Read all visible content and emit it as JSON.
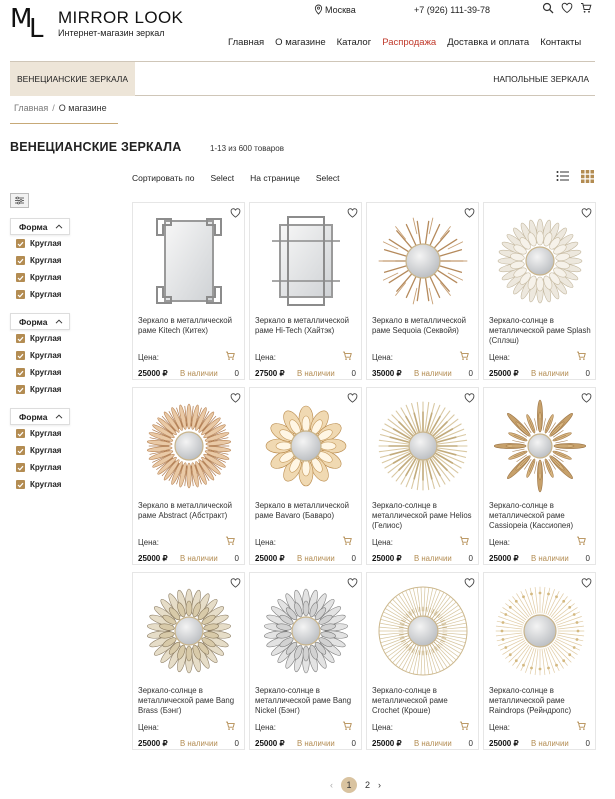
{
  "header": {
    "brand": "MIRROR LOOK",
    "tagline": "Интернет-магазин зеркал",
    "logo_m": "M",
    "logo_l": "L",
    "city": "Москва",
    "phone": "+7 (926) 111-39-78",
    "nav": [
      "Главная",
      "О магазине",
      "Каталог",
      "Распродажа",
      "Доставка и оплата",
      "Контакты"
    ]
  },
  "category_bar": {
    "active": "ВЕНЕЦИАНСКИЕ ЗЕРКАЛА",
    "other": "НАПОЛЬНЫЕ ЗЕРКАЛА"
  },
  "breadcrumbs": {
    "home": "Главная",
    "sep": "/",
    "current": "О магазине"
  },
  "page": {
    "title": "ВЕНЕЦИАНСКИЕ ЗЕРКАЛА",
    "count": "1-13 из 600 товаров"
  },
  "sort": {
    "sort_label": "Сортировать по",
    "sort_value": "Select",
    "per_page_label": "На странице",
    "per_page_value": "Select"
  },
  "filters": [
    {
      "title": "Форма",
      "options": [
        "Круглая",
        "Круглая",
        "Круглая",
        "Круглая"
      ]
    },
    {
      "title": "Форма",
      "options": [
        "Круглая",
        "Круглая",
        "Круглая",
        "Круглая"
      ]
    },
    {
      "title": "Форма",
      "options": [
        "Круглая",
        "Круглая",
        "Круглая",
        "Круглая"
      ]
    }
  ],
  "product_common": {
    "price_label": "Цена:",
    "stock": "В наличии",
    "qty": "0"
  },
  "products": [
    {
      "name": "Зеркало в металлической раме Kitech (Китех)",
      "price": "25000 ₽",
      "kind": "rect-silver"
    },
    {
      "name": "Зеркало в металлической раме Hi-Tech (Хайтэк)",
      "price": "27500 ₽",
      "kind": "rect-silver2"
    },
    {
      "name": "Зеркало в металлической раме Sequoia (Секвойя)",
      "price": "35000 ₽",
      "kind": "branches"
    },
    {
      "name": "Зеркало-солнце в металлической раме Splash (Сплэш)",
      "price": "25000 ₽",
      "kind": "splash"
    },
    {
      "name": "Зеркало в металлической раме Abstract (Абстракт)",
      "price": "25000 ₽",
      "kind": "sun-copper"
    },
    {
      "name": "Зеркало в металлической раме Bavaro (Баваро)",
      "price": "25000 ₽",
      "kind": "flower-gold"
    },
    {
      "name": "Зеркало-солнце в металлической раме Helios (Гелиос)",
      "price": "25000 ₽",
      "kind": "sun-pale"
    },
    {
      "name": "Зеркало-солнце в металлической раме Cassiopeia (Кассиопея)",
      "price": "25000 ₽",
      "kind": "star-bronze"
    },
    {
      "name": "Зеркало-солнце в металлической раме Bang Brass (Бэнг)",
      "price": "25000 ₽",
      "kind": "leaf-brass"
    },
    {
      "name": "Зеркало-солнце в металлической раме Bang Nickel (Бэнг)",
      "price": "25000 ₽",
      "kind": "leaf-nickel"
    },
    {
      "name": "Зеркало-солнце в металлической раме Crochet (Кроше)",
      "price": "25000 ₽",
      "kind": "crochet"
    },
    {
      "name": "Зеркало-солнце в металлической раме Raindrops (Рейндропс)",
      "price": "25000 ₽",
      "kind": "raindrops"
    }
  ],
  "pagination": {
    "prev": "‹",
    "current": "1",
    "next_page": "2",
    "next": "›"
  },
  "colors": {
    "accent": "#b38c52",
    "sale": "#c0392b",
    "category_bg": "#ede5d8"
  }
}
